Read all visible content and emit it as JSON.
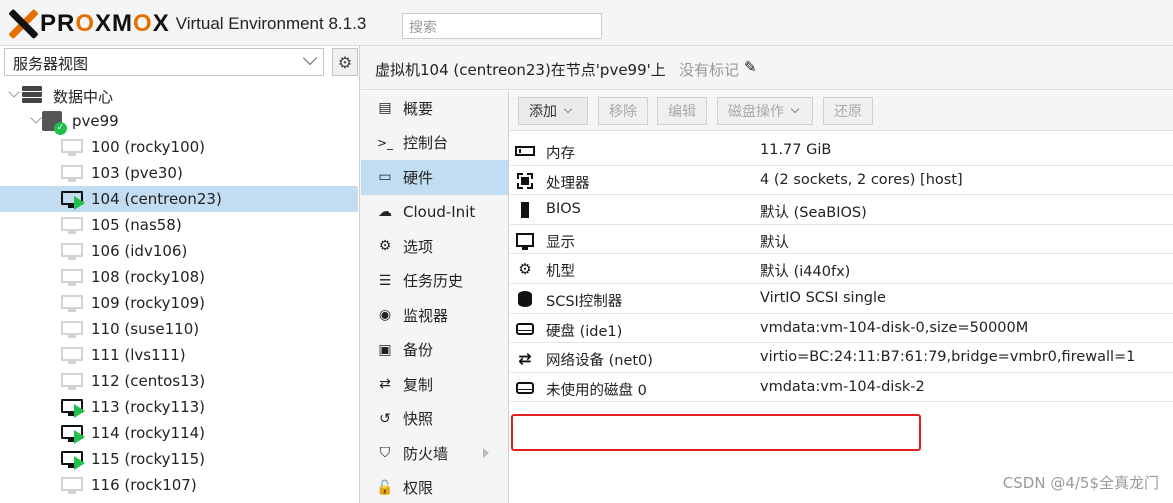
{
  "header": {
    "brand_pre": "PR",
    "brand_o1": "O",
    "brand_mid": "XM",
    "brand_o2": "O",
    "brand_post": "X",
    "version": "Virtual Environment 8.1.3",
    "search_placeholder": "搜索"
  },
  "left": {
    "view_select": "服务器视图",
    "datacenter": "数据中心",
    "node": "pve99",
    "vms": [
      {
        "label": "100 (rocky100)",
        "running": false
      },
      {
        "label": "103 (pve30)",
        "running": false
      },
      {
        "label": "104 (centreon23)",
        "running": true,
        "selected": true
      },
      {
        "label": "105 (nas58)",
        "running": false
      },
      {
        "label": "106 (idv106)",
        "running": false
      },
      {
        "label": "108 (rocky108)",
        "running": false
      },
      {
        "label": "109 (rocky109)",
        "running": false
      },
      {
        "label": "110 (suse110)",
        "running": false
      },
      {
        "label": "111 (lvs111)",
        "running": false
      },
      {
        "label": "112 (centos13)",
        "running": false
      },
      {
        "label": "113 (rocky113)",
        "running": true
      },
      {
        "label": "114 (rocky114)",
        "running": true
      },
      {
        "label": "115 (rocky115)",
        "running": true
      },
      {
        "label": "116 (rock107)",
        "running": false
      }
    ]
  },
  "title": {
    "text": "虚拟机104 (centreon23)在节点'pve99'上",
    "tags": "没有标记"
  },
  "nav": [
    {
      "label": "概要",
      "icon": "summary-icon"
    },
    {
      "label": "控制台",
      "icon": "console-icon"
    },
    {
      "label": "硬件",
      "icon": "monitor-icon",
      "selected": true
    },
    {
      "label": "Cloud-Init",
      "icon": "cloud-icon"
    },
    {
      "label": "选项",
      "icon": "gear-icon"
    },
    {
      "label": "任务历史",
      "icon": "list-icon"
    },
    {
      "label": "监视器",
      "icon": "eye-icon"
    },
    {
      "label": "备份",
      "icon": "floppy-icon"
    },
    {
      "label": "复制",
      "icon": "retweet-icon"
    },
    {
      "label": "快照",
      "icon": "history-icon"
    },
    {
      "label": "防火墙",
      "icon": "shield-icon",
      "submenu": true
    },
    {
      "label": "权限",
      "icon": "unlock-icon"
    }
  ],
  "toolbar": {
    "add": "添加",
    "remove": "移除",
    "edit": "编辑",
    "disk_action": "磁盘操作",
    "revert": "还原"
  },
  "hardware": [
    {
      "key": "内存",
      "value": "11.77 GiB",
      "icon": "memory-icon"
    },
    {
      "key": "处理器",
      "value": "4 (2 sockets, 2 cores) [host]",
      "icon": "cpu-icon"
    },
    {
      "key": "BIOS",
      "value": "默认 (SeaBIOS)",
      "icon": "chip-icon"
    },
    {
      "key": "显示",
      "value": "默认",
      "icon": "display-icon"
    },
    {
      "key": "机型",
      "value": "默认 (i440fx)",
      "icon": "cogs-icon"
    },
    {
      "key": "SCSI控制器",
      "value": "VirtIO SCSI single",
      "icon": "database-icon"
    },
    {
      "key": "硬盘 (ide1)",
      "value": "vmdata:vm-104-disk-0,size=50000M",
      "icon": "hdd-icon"
    },
    {
      "key": "网络设备 (net0)",
      "value": "virtio=BC:24:11:B7:61:79,bridge=vmbr0,firewall=1",
      "icon": "exchange-icon"
    },
    {
      "key": "未使用的磁盘 0",
      "value": "vmdata:vm-104-disk-2",
      "icon": "hdd-icon"
    }
  ],
  "watermark": "CSDN @4/5$全真龙门",
  "colors": {
    "accent": "#e57000",
    "selected": "#c2ddf2",
    "running": "#21bf4b",
    "highlight": "#e02020"
  }
}
